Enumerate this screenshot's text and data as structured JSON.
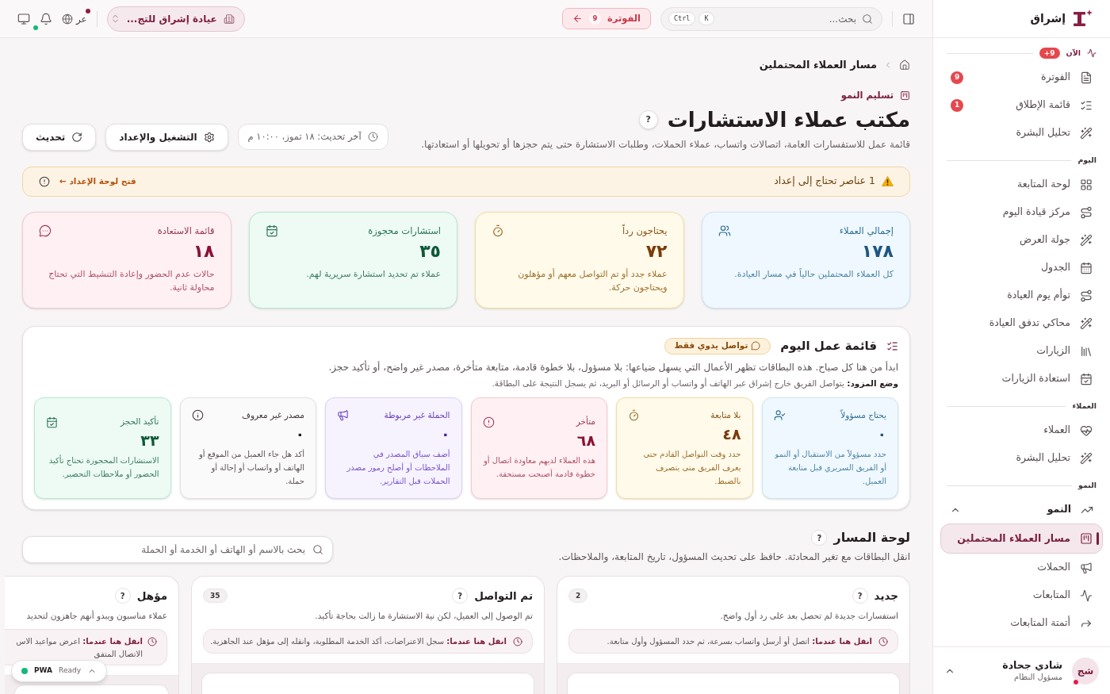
{
  "sidebar": {
    "brand": "إشراق",
    "sections": [
      {
        "title": "الآن",
        "badge": "9+",
        "items": [
          {
            "label": "الفوترة",
            "badge": "9",
            "selected": false
          },
          {
            "label": "قائمة الإطلاق",
            "badge": "1",
            "selected": false
          },
          {
            "label": "تحليل البشرة",
            "selected": false
          }
        ]
      },
      {
        "title": "اليوم",
        "items": [
          {
            "label": "لوحة المتابعة",
            "selected": false
          },
          {
            "label": "مركز قيادة اليوم",
            "selected": false
          },
          {
            "label": "جولة العرض",
            "selected": false
          },
          {
            "label": "الجدول",
            "selected": false
          },
          {
            "label": "توأم يوم العيادة",
            "selected": false
          },
          {
            "label": "محاكي تدفق العيادة",
            "selected": false
          },
          {
            "label": "الزيارات",
            "selected": false
          },
          {
            "label": "استعادة الزيارات",
            "selected": false
          }
        ]
      },
      {
        "title": "العملاء",
        "items": [
          {
            "label": "العملاء",
            "selected": false
          },
          {
            "label": "تحليل البشرة",
            "selected": false
          }
        ]
      },
      {
        "title": "النمو",
        "items": [
          {
            "label": "النمو",
            "selected": false,
            "expanded": true,
            "children": [
              {
                "label": "مسار العملاء المحتملين",
                "selected": true
              },
              {
                "label": "الحملات",
                "selected": false
              },
              {
                "label": "المتابعات",
                "selected": false
              },
              {
                "label": "أتمتة المتابعات",
                "selected": false
              }
            ]
          }
        ]
      }
    ],
    "user": {
      "initials": "شج",
      "name": "شادي جحادة",
      "role": "مسؤول النظام"
    }
  },
  "topbar": {
    "search": {
      "placeholder": "بحث...",
      "keys": [
        "K",
        "Ctrl"
      ]
    },
    "billing": {
      "label": "الفوترة",
      "badge": "9"
    },
    "clinic": {
      "value": "عيادة إشراق للتج..."
    },
    "language": "عر"
  },
  "breadcrumb": {
    "current": "مسار العملاء المحتملين"
  },
  "header": {
    "eyebrow": "تسليم النمو",
    "title": "مكتب عملاء الاستشارات",
    "help": "?",
    "subtitle": "قائمة عمل للاستفسارات العامة، اتصالات واتساب، عملاء الحملات، وطلبات الاستشارة حتى يتم حجزها أو تحويلها أو استعادتها.",
    "last_updated": "آخر تحديث: ١٨ تموز، ١٠:٠٠ م",
    "actions": [
      "التشغيل والإعداد",
      "تحديث"
    ]
  },
  "alert": {
    "message": "1 عناصر تحتاج إلى إعداد",
    "link": "فتح لوحة الإعداد ←"
  },
  "stats": [
    {
      "title": "إجمالي العملاء",
      "value": "١٧٨",
      "description": "كل العملاء المحتملين حالياً في مسار العيادة.",
      "kind": "info"
    },
    {
      "title": "يحتاجون رداً",
      "value": "٧٢",
      "description": "عملاء جدد أو تم التواصل معهم أو مؤهلون ويحتاجون حركة.",
      "kind": "warning"
    },
    {
      "title": "استشارات محجوزة",
      "value": "٣٥",
      "description": "عملاء تم تحديد استشارة سريرية لهم.",
      "kind": "success"
    },
    {
      "title": "قائمة الاستعادة",
      "value": "١٨",
      "description": "حالات عدم الحضور وإعادة التنشيط التي تحتاج محاولة ثانية.",
      "kind": "danger"
    }
  ],
  "worklist": {
    "title": "قائمة عمل اليوم",
    "chip": "تواصل يدوي فقط",
    "intro": "ابدأ من هنا كل صباح. هذه البطاقات تظهر الأعمال التي يسهل ضياعها: بلا مسؤول، بلا خطوة قادمة، متابعة متأخرة، مصدر غير واضح، أو تأكيد حجز.",
    "mode_note": "**وضع المزود:** يتواصل الفريق خارج إشراق عبر الهاتف أو واتساب أو الرسائل أو البريد، ثم يسجل النتيجة على البطاقة.",
    "cards": [
      {
        "title": "يحتاج مسؤولاً",
        "value": "٠",
        "description": "حدد مسؤولاً من الاستقبال أو النمو أو الفريق السريري قبل متابعة العميل.",
        "kind": "info"
      },
      {
        "title": "بلا متابعة",
        "value": "٤٨",
        "description": "حدد وقت التواصل القادم حتى يعرف الفريق متى يتصرف بالضبط.",
        "kind": "warning"
      },
      {
        "title": "متأخر",
        "value": "٦٨",
        "description": "هذه العملاء لديهم معاودة اتصال أو خطوة قادمة أصبحت مستحقة.",
        "kind": "danger"
      },
      {
        "title": "الحملة غير مربوطة",
        "value": "٠",
        "description": "أضف سياق المصدر في الملاحظات أو أصلح رموز مصدر الحملات قبل التقارير.",
        "kind": "violet"
      },
      {
        "title": "مصدر غير معروف",
        "value": "٠",
        "description": "أكد هل جاء العميل من الموقع أو الهاتف أو واتساب أو إحالة أو حملة.",
        "kind": "neutral"
      },
      {
        "title": "تأكيد الحجز",
        "value": "٣٣",
        "description": "الاستشارات المحجوزة تحتاج تأكيد الحضور أو ملاحظات التحضير.",
        "kind": "success"
      }
    ]
  },
  "pipeline": {
    "title": "لوحة المسار",
    "help": "?",
    "subtitle": "انقل البطاقات مع تغير المحادثة. حافظ على تحديث المسؤول، تاريخ المتابعة، والملاحظات.",
    "search": {
      "placeholder": "بحث بالاسم أو الهاتف أو الخدمة أو الحملة"
    },
    "columns": [
      {
        "title": "جديد",
        "help": "?",
        "count": "2",
        "description": "استفسارات جديدة لم تحصل بعد على رد أول واضح.",
        "hint": "**انقل هنا عندما:** اتصل أو أرسل واتساب بسرعة، ثم حدد المسؤول وأول متابعة."
      },
      {
        "title": "تم التواصل",
        "help": "?",
        "count": "35",
        "description": "تم الوصول إلى العميل، لكن نية الاستشارة ما زالت بحاجة تأكيد.",
        "hint": "**انقل هنا عندما:** سجل الاعتراضات، أكد الخدمة المطلوبة، وانقله إلى مؤهل عند الجاهزية."
      },
      {
        "title": "مؤهل",
        "help": "?",
        "description": "عملاء مناسبون ويبدو أنهم جاهزون لتحديد",
        "hint": "**انقل هنا عندما:** اعرض مواعيد الاس",
        "hint_continued": "الاتصال المتفق"
      }
    ]
  },
  "pwa": {
    "label": "PWA",
    "status": "Ready"
  }
}
